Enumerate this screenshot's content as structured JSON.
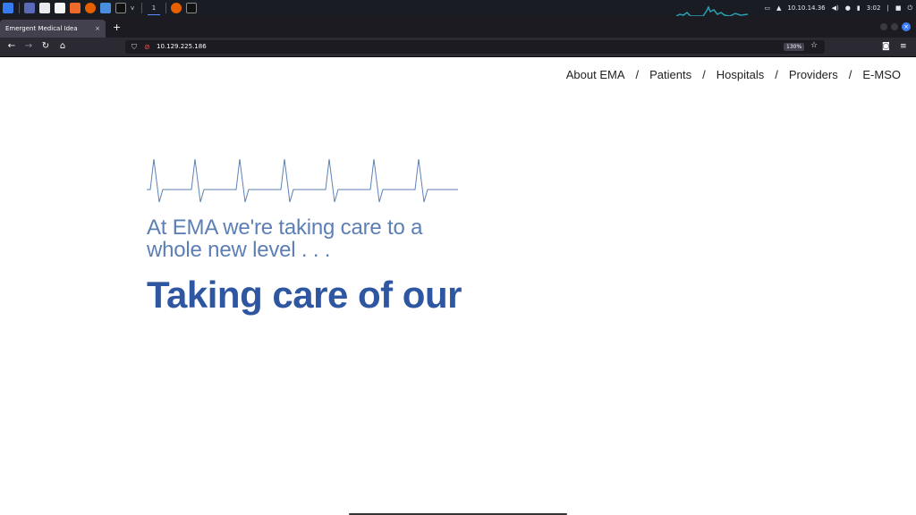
{
  "taskbar": {
    "workspace": "1",
    "network_ip": "10.10.14.36",
    "clock": "3:02"
  },
  "browser": {
    "tab_title": "Emergent Medical Idea",
    "tab_close": "×",
    "new_tab": "+",
    "url": "10.129.225.186",
    "zoom": "130%"
  },
  "site": {
    "nav": [
      "About EMA",
      "Patients",
      "Hospitals",
      "Providers",
      "E-MSO"
    ],
    "separator": "/",
    "tagline": "At EMA we're taking care to a whole new level . . .",
    "headline": "Taking care of our"
  },
  "colors": {
    "accent_dark": "#2f56a0",
    "accent_light": "#5c7fb6",
    "browser_bg": "#2b2a33"
  }
}
